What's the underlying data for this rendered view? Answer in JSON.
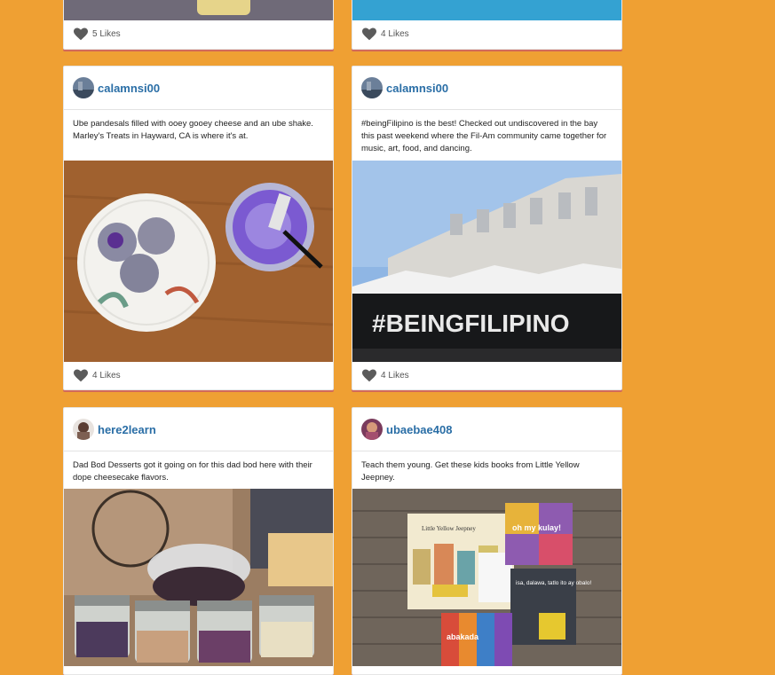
{
  "colors": {
    "background": "#EFA033",
    "username": "#2a6ea6",
    "heart": "#5b5b5b",
    "card_underline": "#d26a5a"
  },
  "icons": {
    "like": "heart-icon"
  },
  "top_row": [
    {
      "likes": "5 Likes"
    },
    {
      "likes": "4 Likes"
    }
  ],
  "posts": [
    {
      "username": "calamnsi00",
      "caption": "Ube pandesals filled with ooey gooey cheese and an ube shake. Marley's Treats in Hayward, CA is where it's at.",
      "likes": "4 Likes"
    },
    {
      "username": "calamnsi00",
      "caption": "#beingFilipino is the best! Checked out undiscovered in the bay this past weekend where the Fil-Am community came together for music, art, food, and dancing.",
      "likes": "4 Likes",
      "photo_text": "#BEINGFILIPINO"
    },
    {
      "username": "here2learn",
      "caption": "Dad Bod Desserts got it going on for this dad bod here with their dope cheesecake flavors."
    },
    {
      "username": "ubaebae408",
      "caption": "Teach them young. Get these kids books from Little Yellow Jeepney.",
      "book_titles": [
        "Little Yellow Jeepney",
        "oh my kulay!",
        "isa, dalawa, tatlo ito ay obalo!",
        "abakada"
      ]
    }
  ]
}
